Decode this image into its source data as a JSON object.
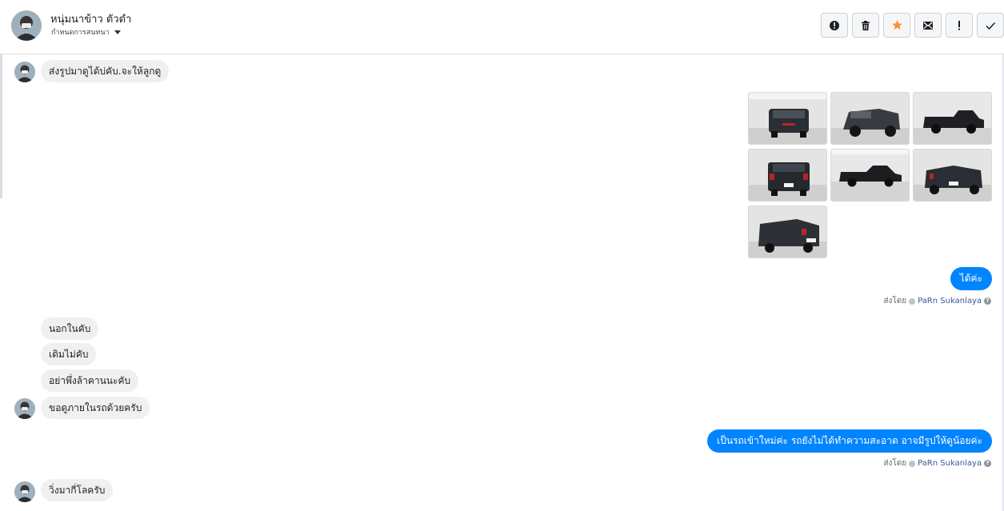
{
  "header": {
    "contact_name": "หนุ่มนาข้าว ตัวดำ",
    "settings_label": "กำหนดการสนทนา",
    "actions": [
      "alert-icon",
      "trash-icon",
      "star-icon",
      "mark-unread-icon",
      "spam-icon",
      "check-icon"
    ],
    "star_color": "#f7923b"
  },
  "messages": {
    "m1": "ส่งรูปมาดูได้บ่คับ.จะให้ลูกดู",
    "m2": "ได้ค่ะ",
    "sent_by_1": {
      "prefix": "ส่งโดย",
      "sender": "PaRn Sukanlaya"
    },
    "m3": "นอกในคับ",
    "m4": "เดิมไม่คับ",
    "m5": "อย่าพึ่งล้าคานนะคับ",
    "m6": "ขอดูภายในรถด้วยครับ",
    "m7": "เป็นรถเข้าใหม่ค่ะ รถยังไม่ได้ทำความสะอาด อาจมีรูปให้ดูน้อยค่ะ",
    "sent_by_2": {
      "prefix": "ส่งโดย",
      "sender": "PaRn Sukanlaya"
    },
    "m8": "วิ่งมากี่โลครับ"
  },
  "photos": {
    "count": 7,
    "subject": "black pickup truck",
    "views": [
      "front",
      "front-three-quarter",
      "side",
      "rear",
      "side-low",
      "rear-three-quarter",
      "rear-three-quarter-2"
    ]
  },
  "colors": {
    "outgoing_bubble": "#0084ff",
    "incoming_bubble": "#f0f0f0",
    "sender_link": "#385898"
  }
}
